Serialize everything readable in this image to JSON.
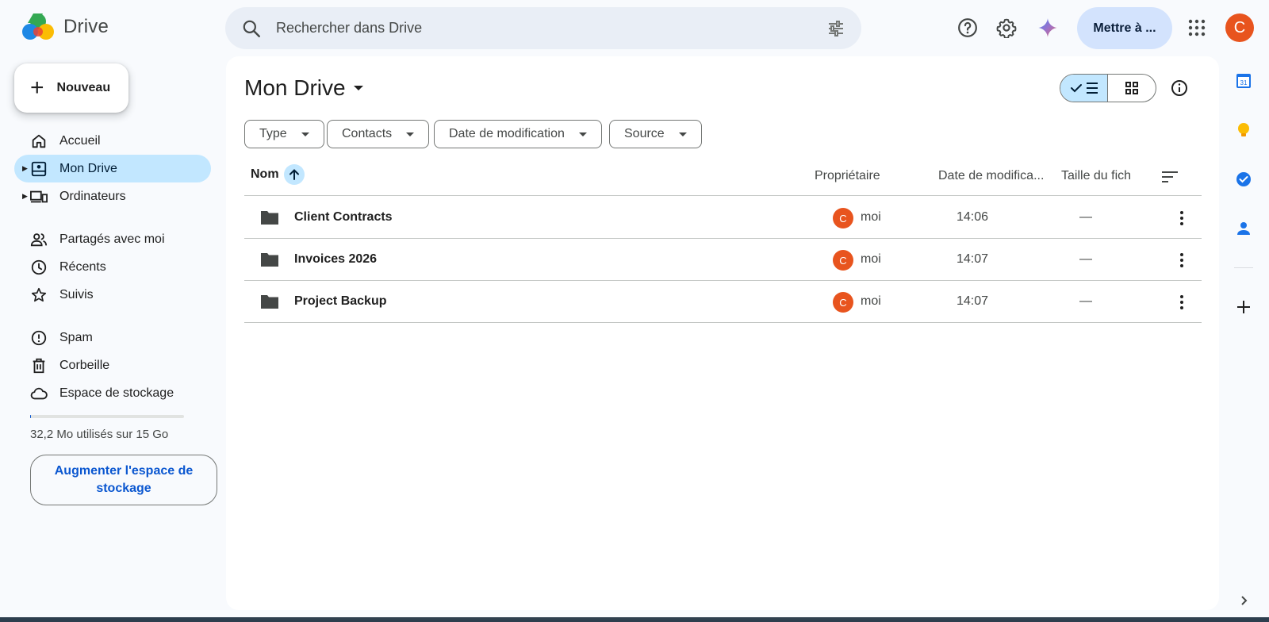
{
  "app": {
    "name": "Drive"
  },
  "search": {
    "placeholder": "Rechercher dans Drive"
  },
  "topbar": {
    "upgrade_label": "Mettre à ...",
    "avatar_letter": "C"
  },
  "sidebar": {
    "new_label": "Nouveau",
    "items": [
      {
        "label": "Accueil",
        "icon": "home-icon"
      },
      {
        "label": "Mon Drive",
        "icon": "my-drive-icon",
        "active": true
      },
      {
        "label": "Ordinateurs",
        "icon": "computers-icon"
      },
      {
        "label": "Partagés avec moi",
        "icon": "shared-icon"
      },
      {
        "label": "Récents",
        "icon": "recent-icon"
      },
      {
        "label": "Suivis",
        "icon": "star-icon"
      },
      {
        "label": "Spam",
        "icon": "spam-icon"
      },
      {
        "label": "Corbeille",
        "icon": "trash-icon"
      },
      {
        "label": "Espace de stockage",
        "icon": "cloud-icon"
      }
    ],
    "storage_text": "32,2 Mo utilisés sur 15 Go",
    "storage_button": "Augmenter l'espace de stockage"
  },
  "main": {
    "title": "Mon Drive",
    "filters": [
      "Type",
      "Contacts",
      "Date de modification",
      "Source"
    ],
    "columns": {
      "name": "Nom",
      "owner": "Propriétaire",
      "modified": "Date de modifica...",
      "size": "Taille du fich"
    },
    "rows": [
      {
        "name": "Client Contracts",
        "owner_letter": "C",
        "owner": "moi",
        "modified": "14:06",
        "size": "—"
      },
      {
        "name": "Invoices 2026",
        "owner_letter": "C",
        "owner": "moi",
        "modified": "14:07",
        "size": "—"
      },
      {
        "name": "Project Backup",
        "owner_letter": "C",
        "owner": "moi",
        "modified": "14:07",
        "size": "—"
      }
    ]
  },
  "colors": {
    "accent": "#0b57d0",
    "active_bg": "#c2e7ff",
    "avatar": "#e8541e"
  }
}
